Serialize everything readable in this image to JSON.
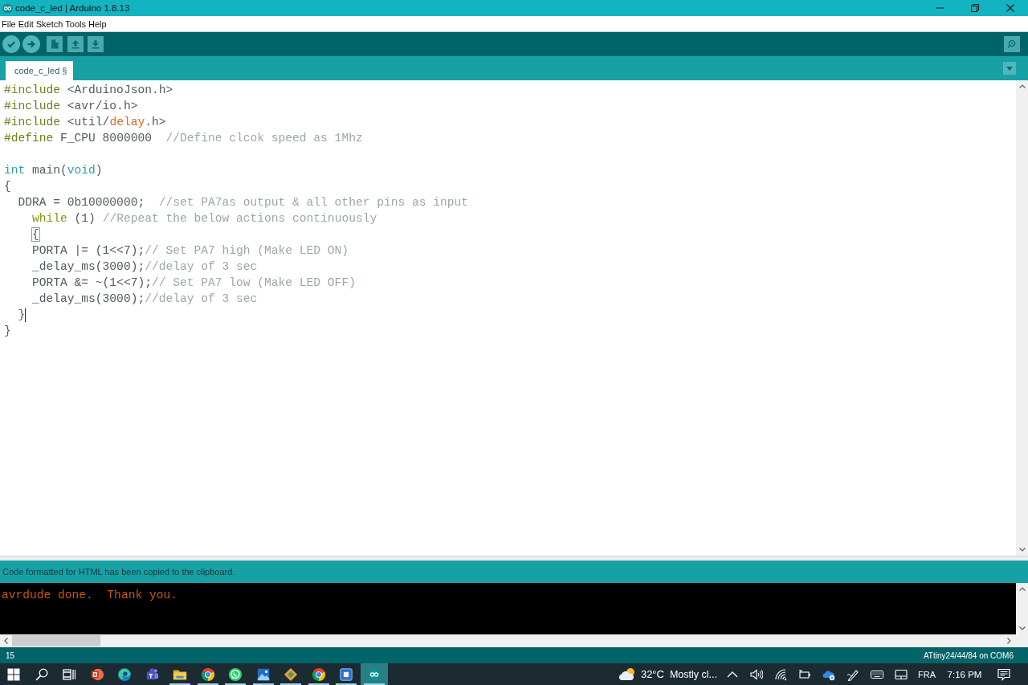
{
  "window": {
    "title": "code_c_led | Arduino 1.8.13"
  },
  "menu": [
    "File",
    "Edit",
    "Sketch",
    "Tools",
    "Help"
  ],
  "tabs": [
    {
      "label": "code_c_led §",
      "selected": true
    }
  ],
  "editor": {
    "lines": [
      {
        "cursor": false,
        "tokens": [
          {
            "text": "#include",
            "kind": "directive"
          },
          {
            "text": " <ArduinoJson.h>",
            "kind": "plain"
          }
        ]
      },
      {
        "cursor": false,
        "tokens": [
          {
            "text": "#include",
            "kind": "directive"
          },
          {
            "text": " <avr/io.h>",
            "kind": "plain"
          }
        ]
      },
      {
        "cursor": false,
        "tokens": [
          {
            "text": "#include",
            "kind": "directive"
          },
          {
            "text": " <util/",
            "kind": "plain"
          },
          {
            "text": "delay",
            "kind": "function"
          },
          {
            "text": ".h>",
            "kind": "plain"
          }
        ]
      },
      {
        "cursor": false,
        "tokens": [
          {
            "text": "#define",
            "kind": "directive"
          },
          {
            "text": " F_CPU 8000000  ",
            "kind": "plain"
          },
          {
            "text": "//Define clcok speed as 1Mhz",
            "kind": "comment"
          }
        ]
      },
      {
        "cursor": false
      },
      {
        "cursor": false,
        "tokens": [
          {
            "text": "int",
            "kind": "type"
          },
          {
            "text": " main(",
            "kind": "plain"
          },
          {
            "text": "void",
            "kind": "type"
          },
          {
            "text": ")",
            "kind": "plain"
          }
        ]
      },
      {
        "cursor": false,
        "tokens": [
          {
            "text": "{",
            "kind": "plain"
          }
        ]
      },
      {
        "cursor": false,
        "tokens": [
          {
            "text": "  DDRA = 0b10000000;  ",
            "kind": "plain"
          },
          {
            "text": "//set PA7as output & all other pins as input",
            "kind": "comment"
          }
        ]
      },
      {
        "cursor": false,
        "tokens": [
          {
            "text": "    while",
            "kind": "keyword"
          },
          {
            "text": " (1) ",
            "kind": "plain"
          },
          {
            "text": "//Repeat the below actions continuously",
            "kind": "comment"
          }
        ]
      },
      {
        "cursor": false,
        "tokens": [
          {
            "text": "    {",
            "kind": "bracket_match"
          }
        ]
      },
      {
        "cursor": false,
        "tokens": [
          {
            "text": "    PORTA |= (1<<7);",
            "kind": "plain"
          },
          {
            "text": "// Set PA7 high (Make LED ON)",
            "kind": "comment"
          }
        ]
      },
      {
        "cursor": false,
        "tokens": [
          {
            "text": "    _delay_ms(3000);",
            "kind": "plain"
          },
          {
            "text": "//delay of 3 sec",
            "kind": "comment"
          }
        ]
      },
      {
        "cursor": false,
        "tokens": [
          {
            "text": "    PORTA &= ~(1<<7);",
            "kind": "plain"
          },
          {
            "text": "// Set PA7 low (Make LED OFF)",
            "kind": "comment"
          }
        ]
      },
      {
        "cursor": false,
        "tokens": [
          {
            "text": "    _delay_ms(3000);",
            "kind": "plain"
          },
          {
            "text": "//delay of 3 sec",
            "kind": "comment"
          }
        ]
      },
      {
        "cursor": true,
        "tokens": [
          {
            "text": "  }",
            "kind": "plain"
          }
        ]
      },
      {
        "cursor": false,
        "tokens": [
          {
            "text": "}",
            "kind": "plain"
          }
        ]
      }
    ]
  },
  "status_message": "Code formatted for HTML has been copied to the clipboard.",
  "console": {
    "lines": [
      "avrdude done.  Thank you."
    ]
  },
  "status_bar": {
    "line": "15",
    "board": "ATtiny24/44/84 on COM6"
  },
  "taskbar": {
    "apps": [
      {
        "kind": "slides",
        "running": false,
        "selected": false
      },
      {
        "kind": "browser_wave",
        "running": false,
        "selected": false
      },
      {
        "kind": "team_chat",
        "running": false,
        "selected": false
      },
      {
        "kind": "folder",
        "running": true,
        "selected": false
      },
      {
        "kind": "browser_ring",
        "running": true,
        "selected": false
      },
      {
        "kind": "phone_chat",
        "running": true,
        "selected": false
      },
      {
        "kind": "picture",
        "running": true,
        "selected": false
      },
      {
        "kind": "diamond",
        "running": true,
        "selected": false
      },
      {
        "kind": "browser_ring",
        "running": true,
        "selected": false
      },
      {
        "kind": "square",
        "running": true,
        "selected": false
      },
      {
        "kind": "infinity",
        "running": true,
        "selected": true
      }
    ],
    "weather": {
      "temperature": "32°C",
      "summary": "Mostly cl..."
    },
    "language": "FRA",
    "time": "7:16 PM"
  }
}
